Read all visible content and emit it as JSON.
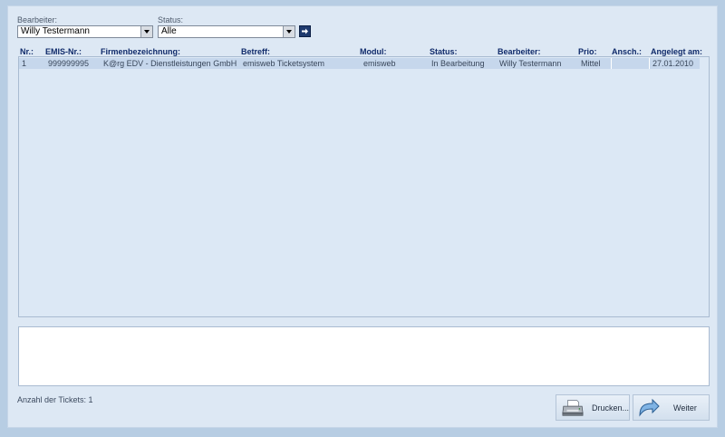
{
  "filters": {
    "bearbeiter_label": "Bearbeiter:",
    "bearbeiter_value": "Willy Testermann",
    "status_label": "Status:",
    "status_value": "Alle"
  },
  "table": {
    "columns": [
      "Nr.:",
      "EMIS-Nr.:",
      "Firmenbezeichnung:",
      "Betreff:",
      "Modul:",
      "Status:",
      "Bearbeiter:",
      "Prio:",
      "Ansch.:",
      "Angelegt am:"
    ],
    "rows": [
      [
        "1",
        "999999995",
        "K@rg EDV - Dienstleistungen GmbH",
        "emisweb Ticketsystem",
        "emisweb",
        "In Bearbeitung",
        "Willy Testermann",
        "Mittel",
        "",
        "27.01.2010"
      ]
    ]
  },
  "footer": {
    "count_text": "Anzahl der Tickets: 1",
    "print_label": "Drucken...",
    "next_label": "Weiter"
  },
  "icons": {
    "go": "arrow-right-icon",
    "print": "printer-icon",
    "next": "curved-arrow-icon"
  }
}
